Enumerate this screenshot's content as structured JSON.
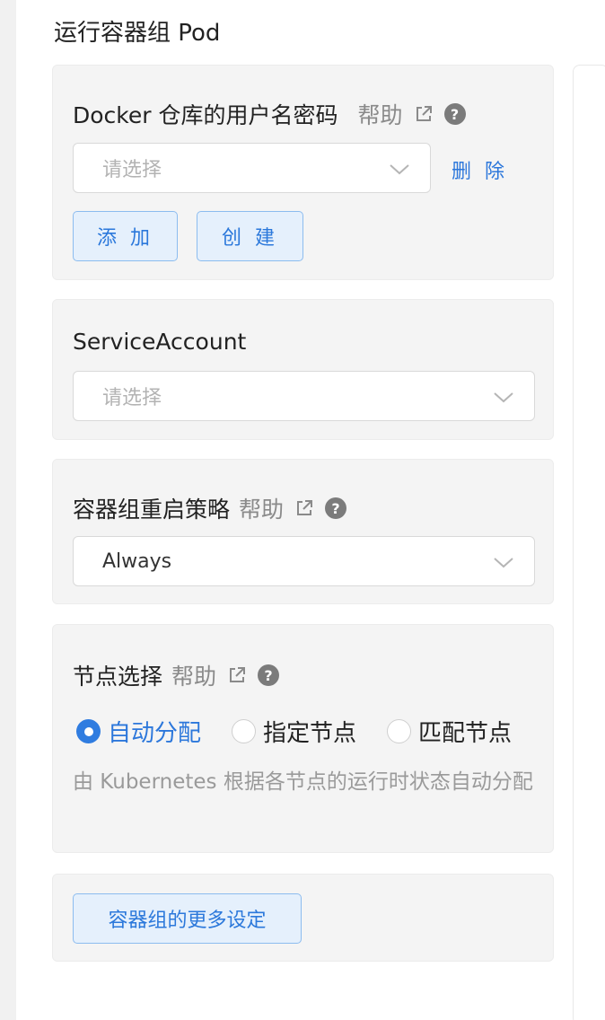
{
  "section": {
    "title": "运行容器组 Pod"
  },
  "docker_secret": {
    "label": "Docker 仓库的用户名密码",
    "help": "帮助",
    "select_placeholder": "请选择",
    "delete_label": "删 除",
    "add_label": "添 加",
    "create_label": "创 建"
  },
  "service_account": {
    "label": "ServiceAccount",
    "select_placeholder": "请选择"
  },
  "restart_policy": {
    "label": "容器组重启策略",
    "help": "帮助",
    "value": "Always"
  },
  "node_selection": {
    "label": "节点选择",
    "help": "帮助",
    "options": [
      {
        "label": "自动分配",
        "checked": true
      },
      {
        "label": "指定节点",
        "checked": false
      },
      {
        "label": "匹配节点",
        "checked": false
      }
    ],
    "description": "由 Kubernetes 根据各节点的运行时状态自动分配"
  },
  "more": {
    "button_label": "容器组的更多设定"
  },
  "colors": {
    "accent": "#2c77db",
    "card_bg": "#f4f4f4",
    "help_gray": "#8a8a8a"
  }
}
